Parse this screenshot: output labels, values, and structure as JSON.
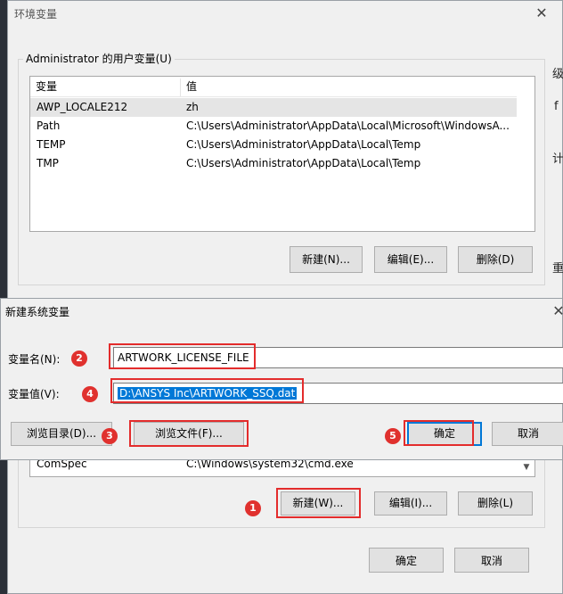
{
  "env_window": {
    "title": "环境变量",
    "user_group": {
      "label": "Administrator 的用户变量(U)",
      "columns": [
        "变量",
        "值"
      ],
      "rows": [
        {
          "name": "AWP_LOCALE212",
          "value": "zh"
        },
        {
          "name": "Path",
          "value": "C:\\Users\\Administrator\\AppData\\Local\\Microsoft\\WindowsA..."
        },
        {
          "name": "TEMP",
          "value": "C:\\Users\\Administrator\\AppData\\Local\\Temp"
        },
        {
          "name": "TMP",
          "value": "C:\\Users\\Administrator\\AppData\\Local\\Temp"
        }
      ],
      "buttons": {
        "new": "新建(N)...",
        "edit": "编辑(E)...",
        "delete": "删除(D)"
      }
    },
    "system_group": {
      "visible_row": {
        "name": "ComSpec",
        "value": "C:\\Windows\\system32\\cmd.exe"
      },
      "buttons": {
        "new": "新建(W)...",
        "edit": "编辑(I)...",
        "delete": "删除(L)"
      }
    },
    "footer": {
      "ok": "确定",
      "cancel": "取消"
    },
    "side_glyphs": [
      "级",
      "f",
      "计",
      "重"
    ]
  },
  "new_var_dialog": {
    "title": "新建系统变量",
    "name_label": "变量名(N):",
    "name_value": "ARTWORK_LICENSE_FILE",
    "value_label": "变量值(V):",
    "value_value": "D:\\ANSYS Inc\\ARTWORK_SSQ.dat",
    "browse_dir": "浏览目录(D)...",
    "browse_file": "浏览文件(F)...",
    "ok": "确定",
    "cancel": "取消"
  },
  "annotations": {
    "b1": "1",
    "b2": "2",
    "b3": "3",
    "b4": "4",
    "b5": "5"
  },
  "colors": {
    "highlight_red": "#e32c2c",
    "badge_red": "#e0312e",
    "selection_blue": "#0078d7"
  }
}
